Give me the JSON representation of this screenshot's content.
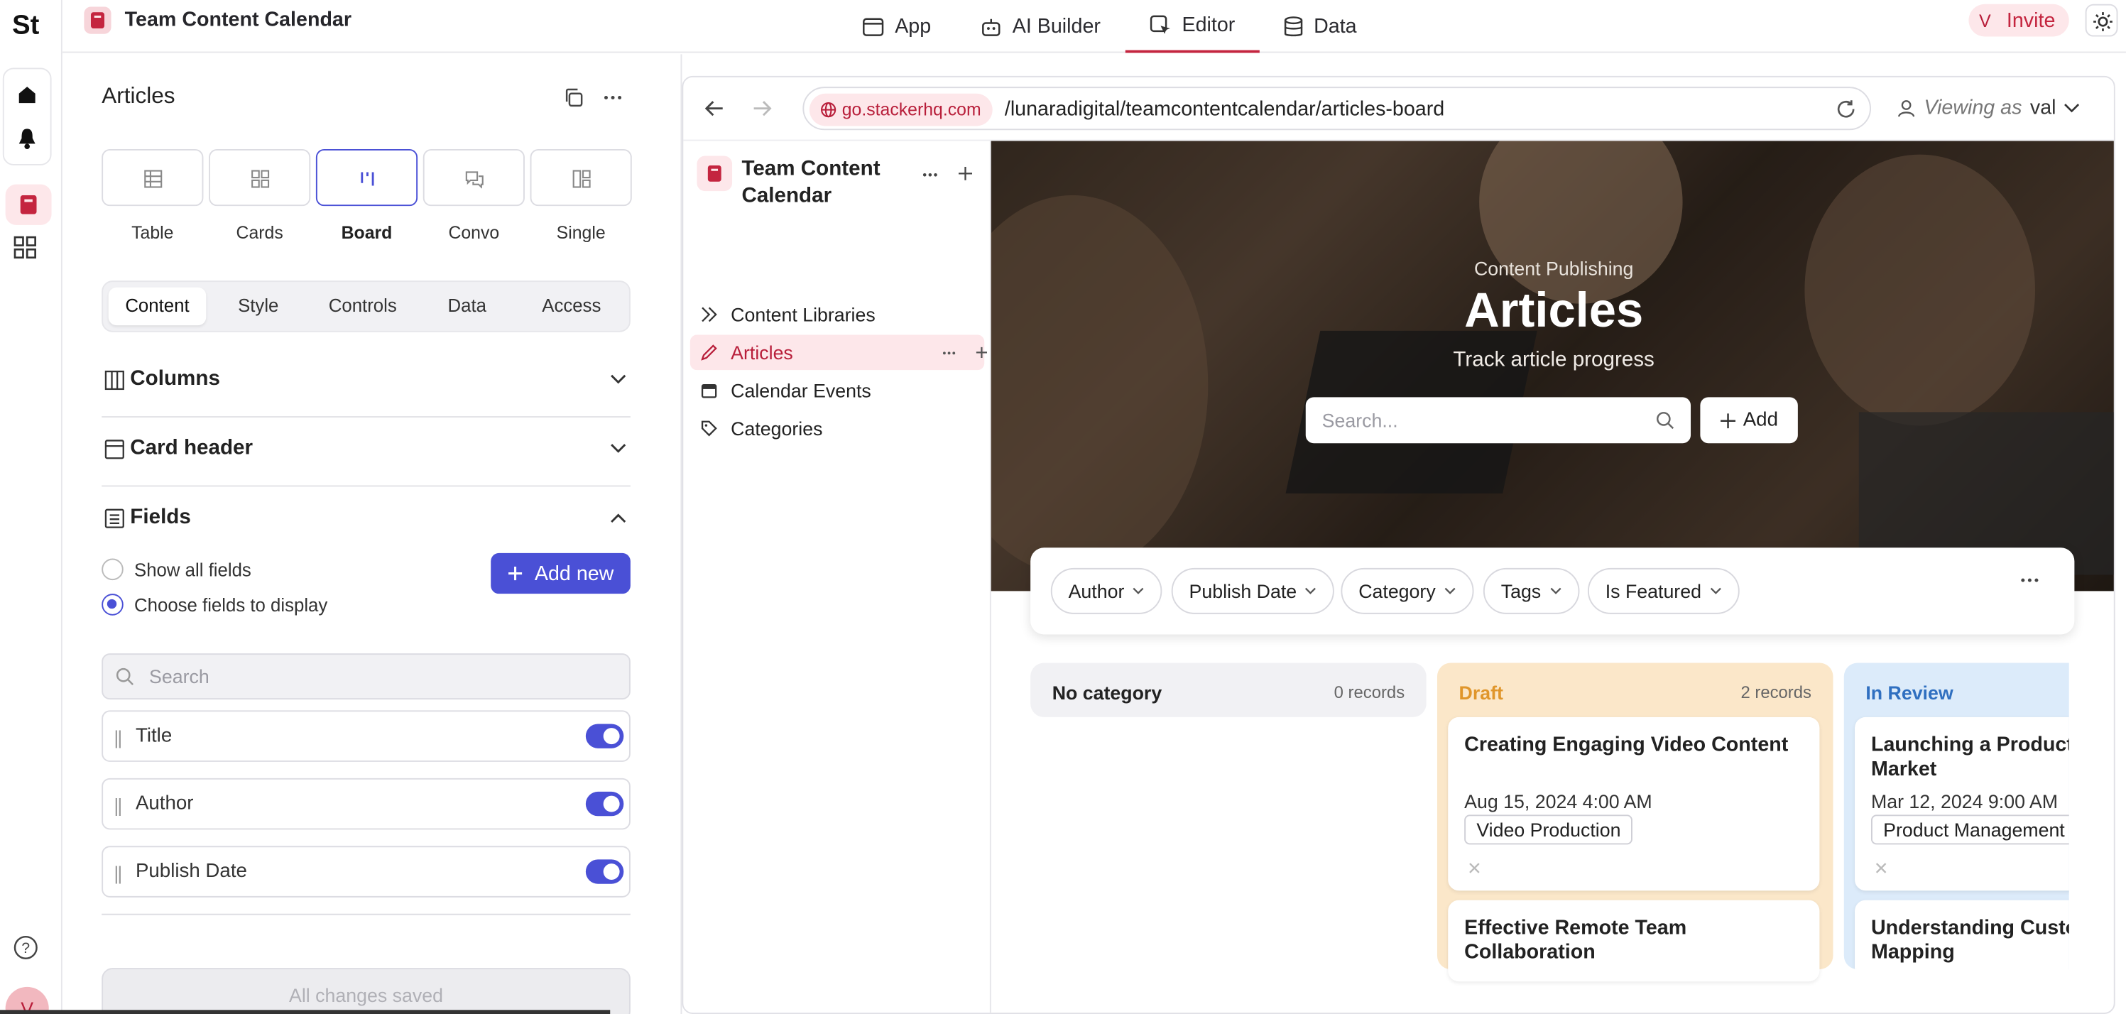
{
  "rail": {
    "logo": "St",
    "avatar": "V"
  },
  "topbar": {
    "app_title": "Team Content Calendar",
    "tabs": [
      {
        "label": "App",
        "icon": "window-icon"
      },
      {
        "label": "AI Builder",
        "icon": "robot-icon"
      },
      {
        "label": "Editor",
        "icon": "cursor-icon"
      },
      {
        "label": "Data",
        "icon": "database-icon"
      }
    ],
    "active_tab": "Editor",
    "invite_avatar": "V",
    "invite_label": "Invite"
  },
  "panel": {
    "title": "Articles",
    "layouts": [
      {
        "label": "Table"
      },
      {
        "label": "Cards"
      },
      {
        "label": "Board"
      },
      {
        "label": "Convo"
      },
      {
        "label": "Single"
      }
    ],
    "active_layout": "Board",
    "subtabs": [
      "Content",
      "Style",
      "Controls",
      "Data",
      "Access"
    ],
    "active_subtab": "Content",
    "sections": [
      {
        "label": "Columns"
      },
      {
        "label": "Card header"
      },
      {
        "label": "Fields"
      }
    ],
    "radio_show_all": "Show all fields",
    "radio_choose": "Choose fields to display",
    "add_new": "Add new",
    "field_search_placeholder": "Search",
    "fields": [
      {
        "label": "Title",
        "enabled": true
      },
      {
        "label": "Author",
        "enabled": true
      },
      {
        "label": "Publish Date",
        "enabled": true
      }
    ],
    "saved_label": "All changes saved"
  },
  "preview": {
    "domain": "go.stackerhq.com",
    "path": "/lunaradigital/teamcontentcalendar/articles-board",
    "viewing_as_label": "Viewing as",
    "viewing_as_user": "val",
    "nav_title": "Team Content Calendar",
    "nav_items": [
      {
        "label": "Content Libraries",
        "icon": "collection-icon"
      },
      {
        "label": "Articles",
        "icon": "pencil-icon"
      },
      {
        "label": "Calendar Events",
        "icon": "calendar-icon"
      },
      {
        "label": "Categories",
        "icon": "tag-icon"
      }
    ],
    "hero": {
      "subtitle": "Content Publishing",
      "title": "Articles",
      "description": "Track article progress",
      "search_placeholder": "Search...",
      "add_label": "Add"
    },
    "filters": [
      "Author",
      "Publish Date",
      "Category",
      "Tags",
      "Is Featured"
    ],
    "columns": [
      {
        "name": "No category",
        "count": "0 records",
        "color": "#f1f1f4",
        "head_color": "#222222",
        "cards": []
      },
      {
        "name": "Draft",
        "count": "2 records",
        "color": "#fbe7c9",
        "head_color": "#e0962b",
        "cards": [
          {
            "title": "Creating Engaging Video Content",
            "date": "Aug 15, 2024 4:00 AM",
            "category": "Video Production"
          },
          {
            "title": "Effective Remote Team Collaboration",
            "date": "",
            "category": ""
          }
        ]
      },
      {
        "name": "In Review",
        "count": "",
        "color": "#dcebfa",
        "head_color": "#2f6fc0",
        "cards": [
          {
            "title": "Launching a Product: Idea to Market",
            "date": "Mar 12, 2024 9:00 AM",
            "category": "Product Management"
          },
          {
            "title": "Understanding Customer Journey Mapping",
            "date": "",
            "category": ""
          }
        ]
      }
    ]
  }
}
